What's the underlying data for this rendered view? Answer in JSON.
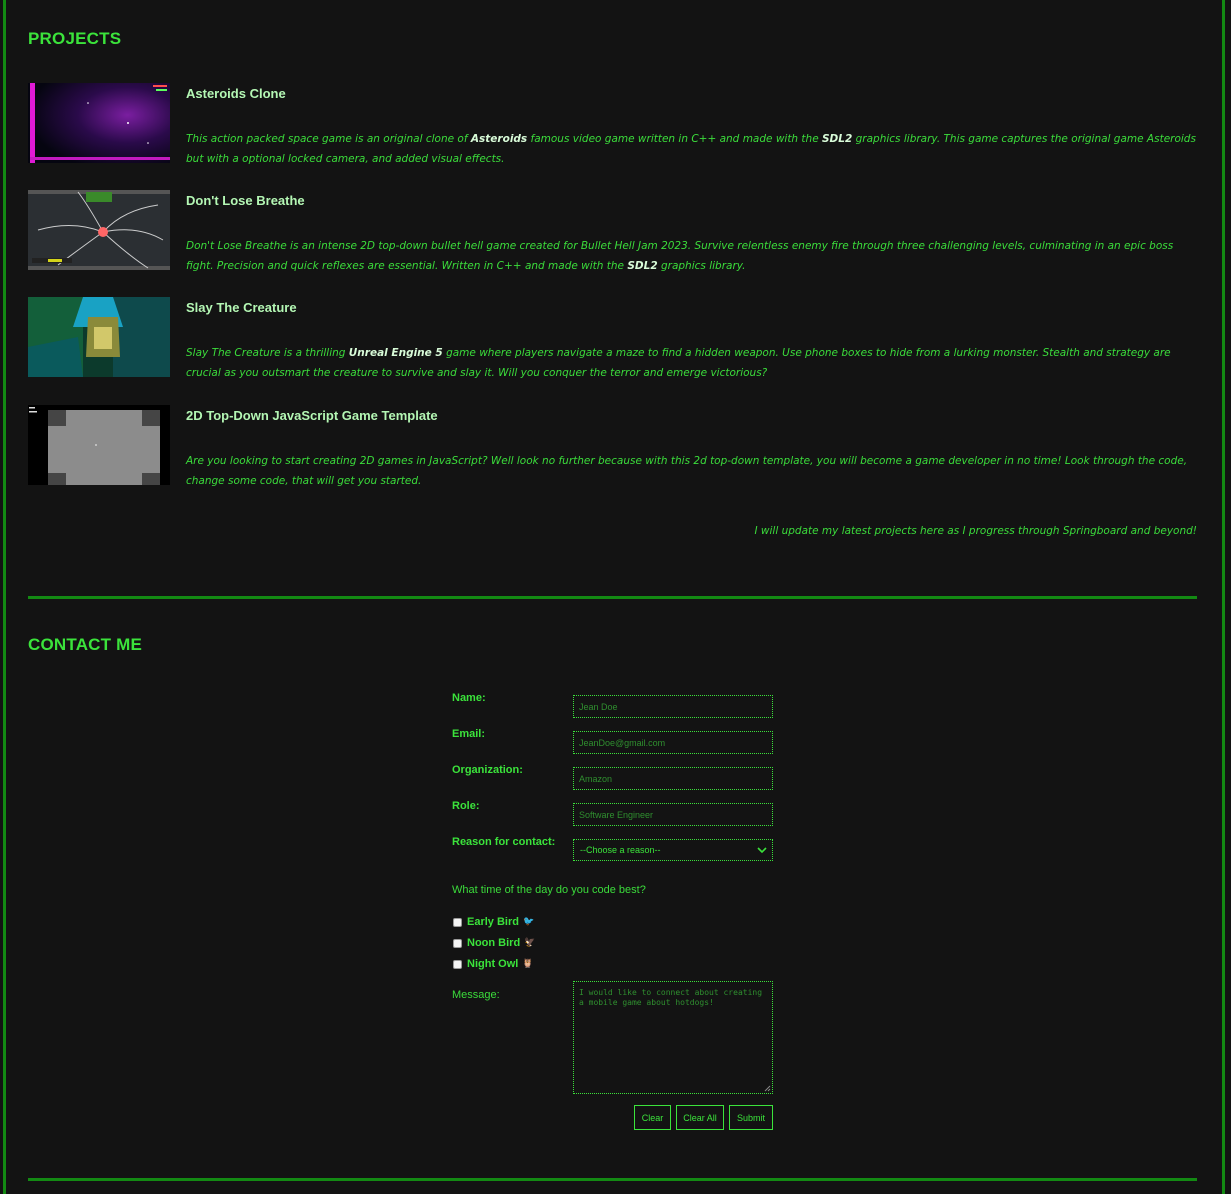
{
  "colors": {
    "background": "#131313",
    "accent": "#3be33b",
    "border": "#138a13"
  },
  "projects_section": {
    "title": "PROJECTS",
    "items": [
      {
        "title": "Asteroids Clone",
        "desc_a": "This action packed space game is an original clone of ",
        "desc_b": "Asteroids",
        "desc_c": " famous video game written in C++ and made with the ",
        "desc_d": "SDL2",
        "desc_e": " graphics library. This game captures the original game Asteroids but with a optional locked camera, and added visual effects."
      },
      {
        "title": "Don't Lose Breathe",
        "desc_a": "Don't Lose Breathe is an intense 2D top-down bullet hell game created for Bullet Hell Jam 2023. Survive relentless enemy fire through three challenging levels, culminating in an epic boss fight. Precision and quick reflexes are essential. Written in C++ and made with the ",
        "desc_b": "SDL2",
        "desc_c": " graphics library."
      },
      {
        "title": "Slay The Creature",
        "desc_a": "Slay The Creature is a thrilling ",
        "desc_b": "Unreal Engine 5",
        "desc_c": " game where players navigate a maze to find a hidden weapon. Use phone boxes to hide from a lurking monster. Stealth and strategy are crucial as you outsmart the creature to survive and slay it. Will you conquer the terror and emerge victorious?"
      },
      {
        "title": "2D Top-Down JavaScript Game Template",
        "desc_a": "Are you looking to start creating 2D games in JavaScript? Well look no further because with this 2d top-down template, you will become a game developer in no time! Look through the code, change some code, that will get you started."
      }
    ],
    "update_note": "I will update my latest projects here as I progress through Springboard and beyond!"
  },
  "contact_section": {
    "title": "CONTACT ME",
    "fields": {
      "name_label": "Name:",
      "name_placeholder": "Jean Doe",
      "email_label": "Email:",
      "email_placeholder": "JeanDoe@gmail.com",
      "org_label": "Organization:",
      "org_placeholder": "Amazon",
      "role_label": "Role:",
      "role_placeholder": "Software Engineer",
      "reason_label": "Reason for contact:",
      "reason_selected": "--Choose a reason--"
    },
    "question": "What time of the day do you code best?",
    "options": [
      {
        "label": "Early Bird",
        "emoji": "🐦"
      },
      {
        "label": "Noon Bird",
        "emoji": "🦅"
      },
      {
        "label": "Night Owl",
        "emoji": "🦉"
      }
    ],
    "message_label": "Message:",
    "message_placeholder": "I would like to connect about creating a mobile game about hotdogs!",
    "buttons": {
      "clear": "Clear",
      "clear_all": "Clear All",
      "submit": "Submit"
    }
  }
}
